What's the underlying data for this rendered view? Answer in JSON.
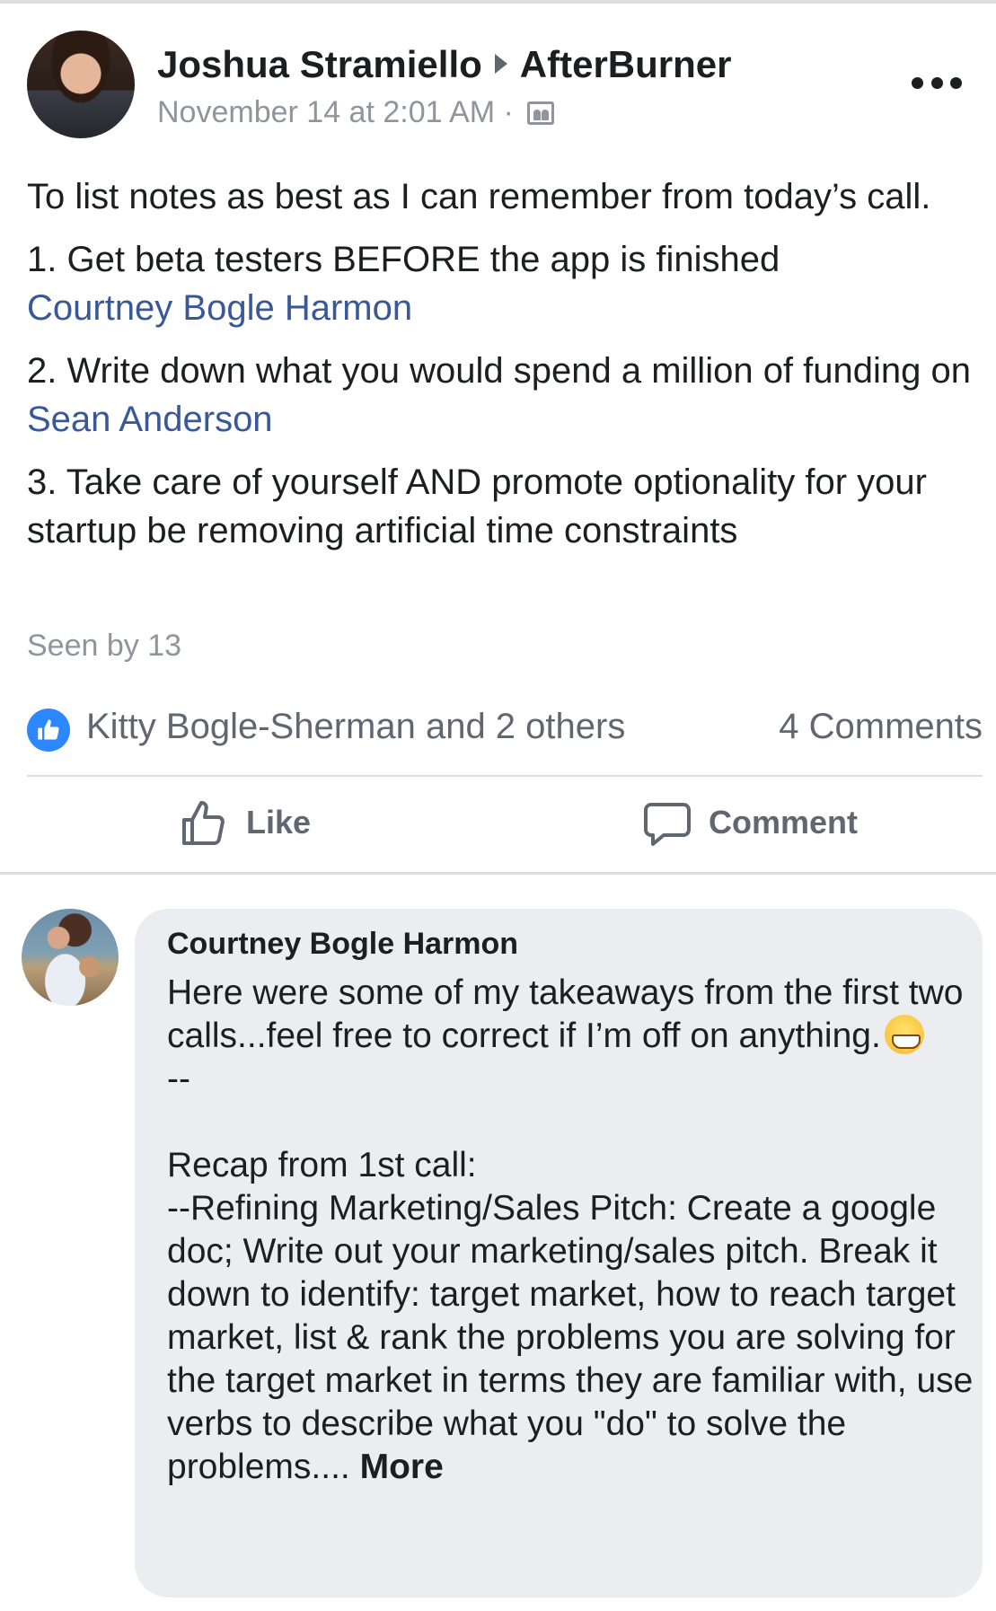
{
  "post": {
    "author": "Joshua Stramiello",
    "group": "AfterBurner",
    "timestamp": "November 14 at 2:01 AM",
    "separator": "·",
    "audience_icon": "group-audience-icon",
    "intro": "To list notes as best as I can remember from today’s call.",
    "item1_text": "1. Get beta testers BEFORE the app is finished",
    "item1_mention": "Courtney Bogle Harmon",
    "item2_text": "2. Write down what you would spend a million of funding on",
    "item2_mention": "Sean Anderson",
    "item3_text": "3. Take care of yourself AND promote optionality for your startup be removing artificial time constraints",
    "seen_by": "Seen by 13"
  },
  "reactions": {
    "names": "Kitty Bogle-Sherman and 2 others",
    "comments_count": "4 Comments",
    "reaction_icon": "like-reaction-icon",
    "accent_color": "#2d88ff"
  },
  "actions": {
    "like_label": "Like",
    "comment_label": "Comment"
  },
  "comment": {
    "author": "Courtney Bogle Harmon",
    "text_part1": "Here were some of my takeaways from the first two calls...feel free to correct if I’m off on anything.",
    "emoji": "grinning-face-emoji",
    "text_part2": "\n--\n\nRecap from 1st call:\n--Refining Marketing/Sales Pitch: Create a google doc; Write out your marketing/sales pitch. Break it down to identify: target market, how to reach target market, list & rank the problems you are solving for the target market in terms they are familiar with, use verbs to describe what you \"do\" to solve the problems.... ",
    "more_label": "More"
  },
  "colors": {
    "mention": "#385898",
    "secondary_text": "#90949c",
    "bubble_bg": "#ebedf0"
  }
}
